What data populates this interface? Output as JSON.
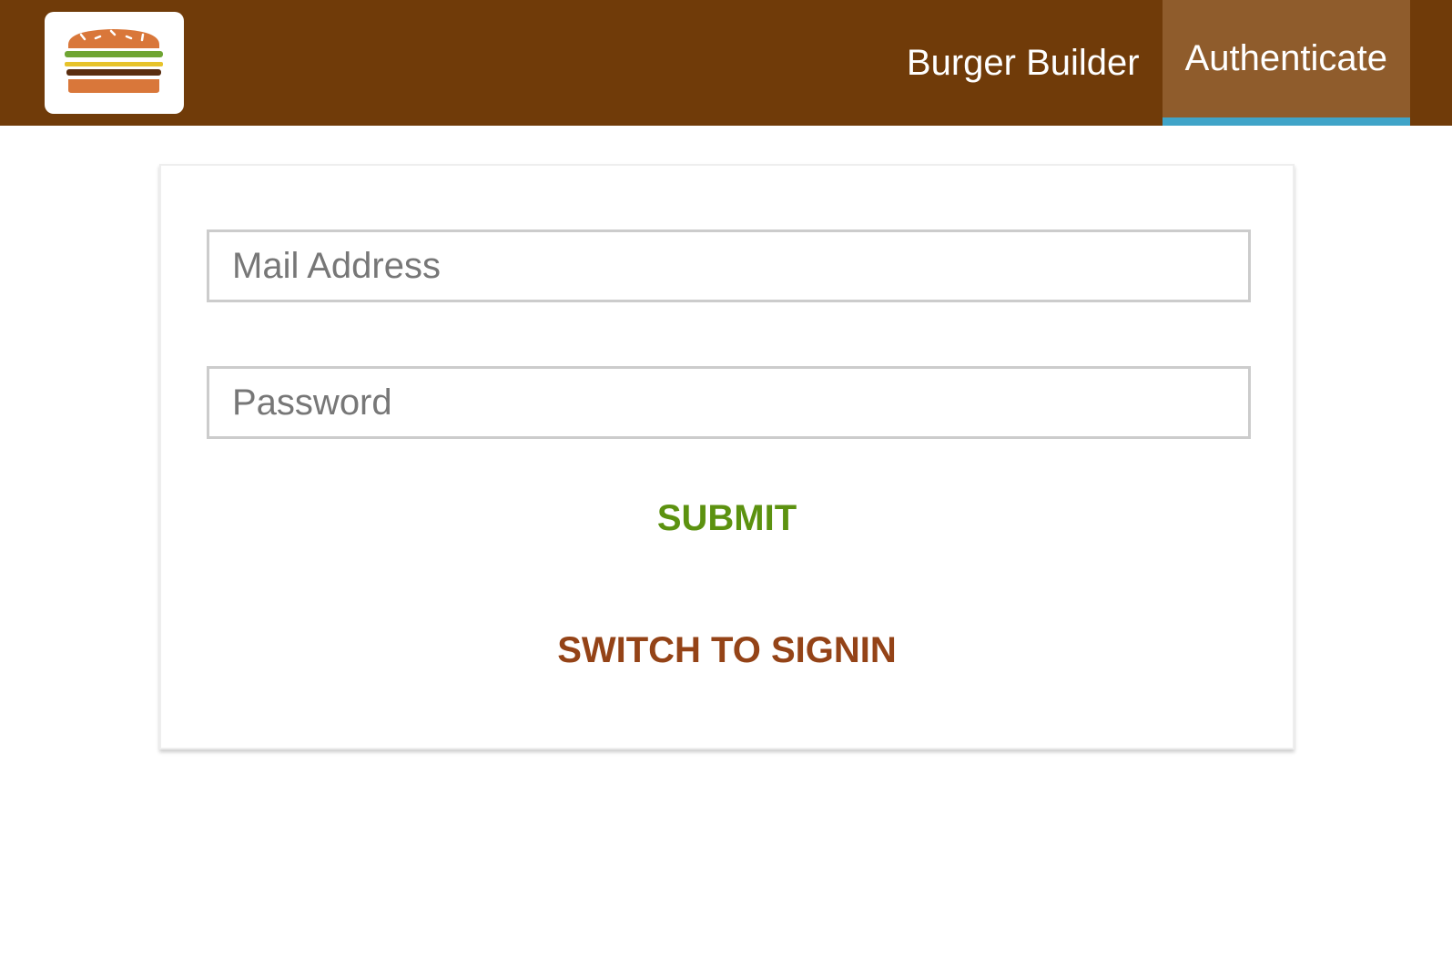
{
  "toolbar": {
    "logo_icon": "burger-logo-icon",
    "nav_items": [
      {
        "label": "Burger Builder",
        "active": false
      },
      {
        "label": "Authenticate",
        "active": true
      }
    ]
  },
  "auth_form": {
    "email": {
      "placeholder": "Mail Address",
      "value": ""
    },
    "password": {
      "placeholder": "Password",
      "value": ""
    },
    "submit_label": "SUBMIT",
    "switch_label": "SWITCH TO SIGNIN"
  },
  "colors": {
    "toolbar_bg": "#703B09",
    "active_nav_bg": "#8F5C2C",
    "active_nav_indicator": "#40A4C8",
    "submit_text": "#5C9210",
    "switch_text": "#944317"
  }
}
